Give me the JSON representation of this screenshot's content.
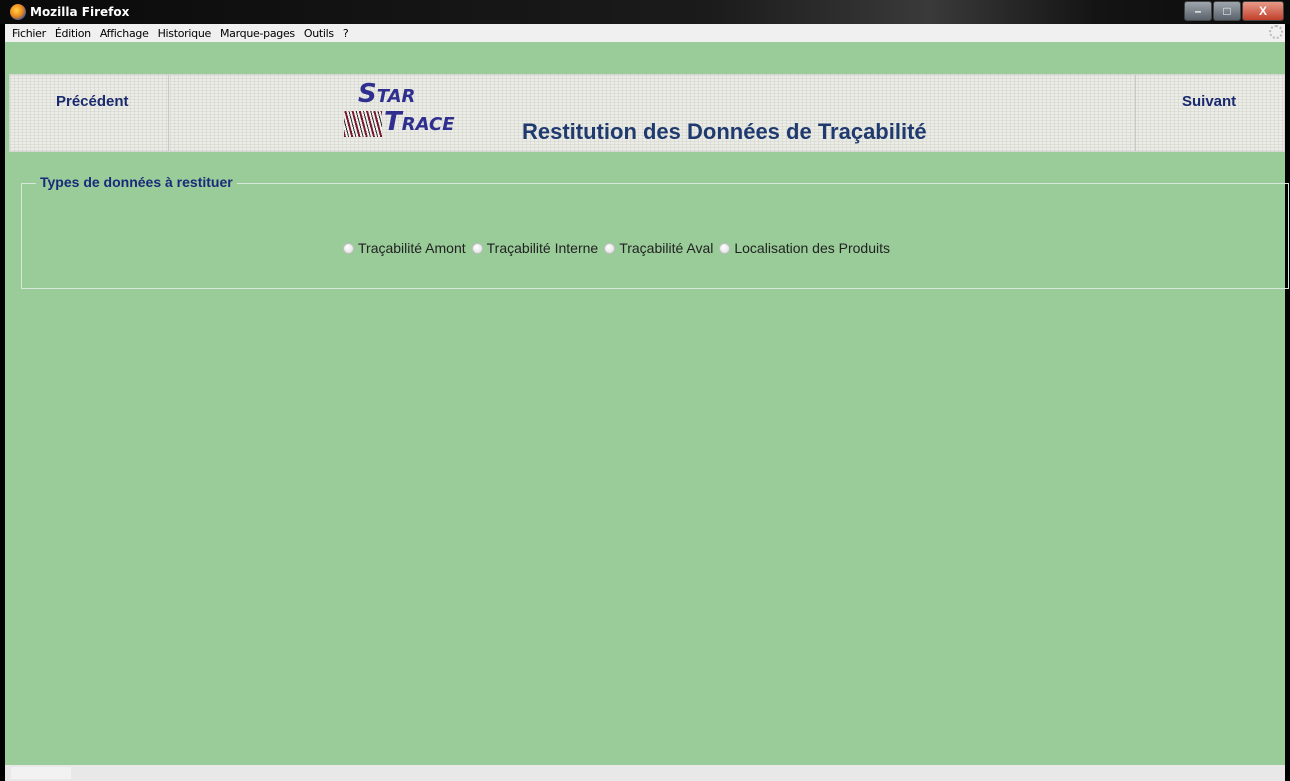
{
  "window": {
    "title": "Mozilla Firefox",
    "controls": {
      "minimize": "–",
      "maximize": "□",
      "close": "X"
    }
  },
  "menubar": {
    "items": [
      "Fichier",
      "Édition",
      "Affichage",
      "Historique",
      "Marque-pages",
      "Outils",
      "?"
    ]
  },
  "header": {
    "prev_label": "Précédent",
    "next_label": "Suivant",
    "logo": {
      "star_first": "S",
      "star_rest": "TAR",
      "trace_first": "T",
      "trace_rest": "RACE"
    },
    "title": "Restitution des Données de Traçabilité"
  },
  "section": {
    "legend": "Types de données à restituer",
    "options": [
      "Traçabilité Amont",
      "Traçabilité Interne",
      "Traçabilité Aval",
      "Localisation des Produits"
    ]
  },
  "colors": {
    "background": "#99cc99",
    "legend_text": "#1a2a7a",
    "title_text": "#1f3a6e"
  }
}
